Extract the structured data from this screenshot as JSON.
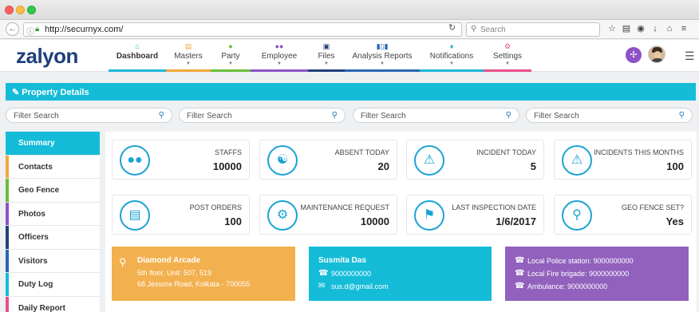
{
  "browser": {
    "url": "http://securnyx.com/",
    "search_placeholder": "Search"
  },
  "app": {
    "logo": "zalyon",
    "menu": [
      {
        "label": "Dashboard",
        "icon": "home-icon",
        "color": "#1cb8d8"
      },
      {
        "label": "Masters",
        "icon": "document-icon",
        "color": "#f0a83a"
      },
      {
        "label": "Party",
        "icon": "user-icon",
        "color": "#6abf3b"
      },
      {
        "label": "Employee",
        "icon": "users-icon",
        "color": "#8e52c9"
      },
      {
        "label": "Files",
        "icon": "folder-icon",
        "color": "#1f3f7a"
      },
      {
        "label": "Analysis Reports",
        "icon": "bar-chart-icon",
        "color": "#2a66b5"
      },
      {
        "label": "Notifications",
        "icon": "bell-icon",
        "color": "#1cb8d8"
      },
      {
        "label": "Settings",
        "icon": "gear-icon",
        "color": "#e8508a"
      }
    ]
  },
  "section": {
    "title": "Property Details"
  },
  "filters": [
    "Filter Search",
    "Filter Search",
    "Filter Search",
    "Filter Search"
  ],
  "sidebar": {
    "items": [
      {
        "label": "Summary",
        "color": "#14bcd8"
      },
      {
        "label": "Contacts",
        "color": "#f0a83a"
      },
      {
        "label": "Geo Fence",
        "color": "#6abf3b"
      },
      {
        "label": "Photos",
        "color": "#8e52c9"
      },
      {
        "label": "Officers",
        "color": "#1f3f7a"
      },
      {
        "label": "Visitors",
        "color": "#2a66b5"
      },
      {
        "label": "Duty Log",
        "color": "#14bcd8"
      },
      {
        "label": "Daily Report",
        "color": "#e8508a"
      }
    ]
  },
  "stats": [
    {
      "label": "STAFFS",
      "value": "10000",
      "icon": "group-icon"
    },
    {
      "label": "ABSENT TODAY",
      "value": "20",
      "icon": "handshake-icon"
    },
    {
      "label": "INCIDENT TODAY",
      "value": "5",
      "icon": "warning-icon"
    },
    {
      "label": "INCIDENTS THIS MONTHS",
      "value": "100",
      "icon": "warning-calendar-icon"
    },
    {
      "label": "POST ORDERS",
      "value": "100",
      "icon": "order-doc-icon"
    },
    {
      "label": "MAINTENANCE REQUEST",
      "value": "10000",
      "icon": "wrench-gear-icon"
    },
    {
      "label": "LAST INSPECTION DATE",
      "value": "1/6/2017",
      "icon": "inspection-icon"
    },
    {
      "label": "GEO FENCE SET?",
      "value": "Yes",
      "icon": "map-pin-icon"
    }
  ],
  "info": {
    "address": {
      "title": "Diamond Arcade",
      "line1": "5th floor, Unit: 507, 519",
      "line2": "68 Jessore Road, Kolkata - 700055",
      "color": "#f3b04e"
    },
    "contact": {
      "name": "Susmita Das",
      "phone": "9000000000",
      "email": "sus.d@gmail.com",
      "color": "#14bcd8"
    },
    "emergency": {
      "police": "Local Police station: 9000000000",
      "fire": "Local Fire brigade: 9000000000",
      "ambulance": "Ambulance: 9000000000",
      "color": "#9161bd"
    }
  }
}
